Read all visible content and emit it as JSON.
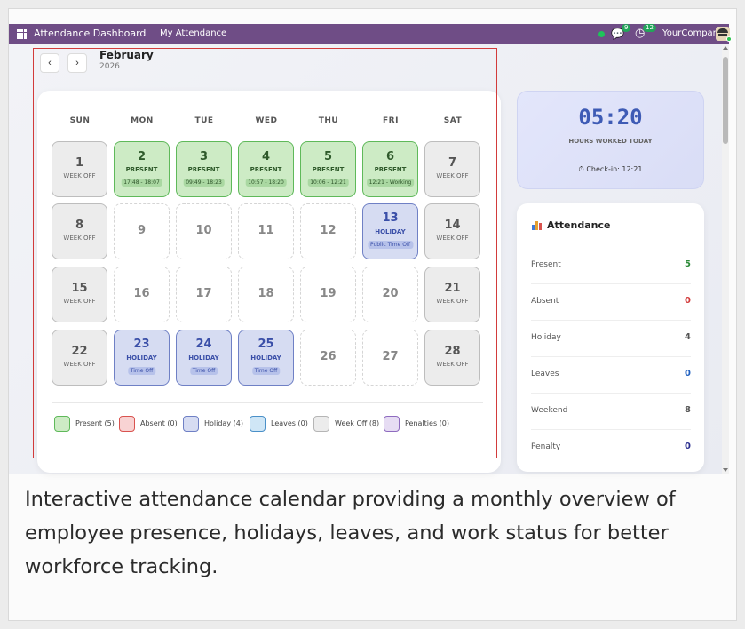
{
  "navbar": {
    "title": "Attendance Dashboard",
    "menu": "My Attendance",
    "chat_badge": "9",
    "activity_badge": "12",
    "company": "YourCompany"
  },
  "calendar": {
    "month": "February",
    "year": "2026",
    "prev_label": "‹",
    "next_label": "›",
    "days_of_week": [
      "SUN",
      "MON",
      "TUE",
      "WED",
      "THU",
      "FRI",
      "SAT"
    ],
    "weeks": [
      [
        {
          "day": "1",
          "type": "off",
          "status": "WEEK OFF"
        },
        {
          "day": "2",
          "type": "present",
          "status": "PRESENT",
          "time": "17:48 - 18:07"
        },
        {
          "day": "3",
          "type": "present",
          "status": "PRESENT",
          "time": "09:49 - 18:23"
        },
        {
          "day": "4",
          "type": "present",
          "status": "PRESENT",
          "time": "10:57 - 18:20"
        },
        {
          "day": "5",
          "type": "present",
          "status": "PRESENT",
          "time": "10:06 - 12:21"
        },
        {
          "day": "6",
          "type": "present",
          "status": "PRESENT",
          "time": "12:21 - Working"
        },
        {
          "day": "7",
          "type": "off",
          "status": "WEEK OFF"
        }
      ],
      [
        {
          "day": "8",
          "type": "off",
          "status": "WEEK OFF"
        },
        {
          "day": "9",
          "type": "empty"
        },
        {
          "day": "10",
          "type": "empty"
        },
        {
          "day": "11",
          "type": "empty"
        },
        {
          "day": "12",
          "type": "empty"
        },
        {
          "day": "13",
          "type": "holiday",
          "status": "HOLIDAY",
          "time": "Public Time Off"
        },
        {
          "day": "14",
          "type": "off",
          "status": "WEEK OFF"
        }
      ],
      [
        {
          "day": "15",
          "type": "off",
          "status": "WEEK OFF"
        },
        {
          "day": "16",
          "type": "empty"
        },
        {
          "day": "17",
          "type": "empty"
        },
        {
          "day": "18",
          "type": "empty"
        },
        {
          "day": "19",
          "type": "empty"
        },
        {
          "day": "20",
          "type": "empty"
        },
        {
          "day": "21",
          "type": "off",
          "status": "WEEK OFF"
        }
      ],
      [
        {
          "day": "22",
          "type": "off",
          "status": "WEEK OFF"
        },
        {
          "day": "23",
          "type": "holiday",
          "status": "HOLIDAY",
          "time": "Time Off"
        },
        {
          "day": "24",
          "type": "holiday",
          "status": "HOLIDAY",
          "time": "Time Off"
        },
        {
          "day": "25",
          "type": "holiday",
          "status": "HOLIDAY",
          "time": "Time Off"
        },
        {
          "day": "26",
          "type": "empty"
        },
        {
          "day": "27",
          "type": "empty"
        },
        {
          "day": "28",
          "type": "off",
          "status": "WEEK OFF"
        }
      ]
    ],
    "legend": [
      {
        "label": "Present (5)",
        "fill": "#cdebc5",
        "border": "#5fb95a"
      },
      {
        "label": "Absent (0)",
        "fill": "#f8d3d3",
        "border": "#d9534f"
      },
      {
        "label": "Holiday (4)",
        "fill": "#d6dcf2",
        "border": "#6f80c5"
      },
      {
        "label": "Leaves (0)",
        "fill": "#cfe6f6",
        "border": "#4a90c8"
      },
      {
        "label": "Week Off (8)",
        "fill": "#ececec",
        "border": "#b5b5b5"
      },
      {
        "label": "Penalties (0)",
        "fill": "#e6dcf3",
        "border": "#8e6bbf"
      }
    ]
  },
  "timer": {
    "time": "05:20",
    "label": "HOURS WORKED TODAY",
    "checkin": "Check-in: 12:21"
  },
  "stats": {
    "title": "Attendance",
    "rows": [
      {
        "label": "Present",
        "value": "5",
        "color": "#2e8b3a"
      },
      {
        "label": "Absent",
        "value": "0",
        "color": "#d23b3b"
      },
      {
        "label": "Holiday",
        "value": "4",
        "color": "#555555"
      },
      {
        "label": "Leaves",
        "value": "0",
        "color": "#1f5fbf"
      },
      {
        "label": "Weekend",
        "value": "8",
        "color": "#555555"
      },
      {
        "label": "Penalty",
        "value": "0",
        "color": "#2b2f8f"
      }
    ]
  },
  "caption": "Interactive attendance calendar providing a monthly overview of employee presence, holidays, leaves, and work status for better workforce tracking."
}
